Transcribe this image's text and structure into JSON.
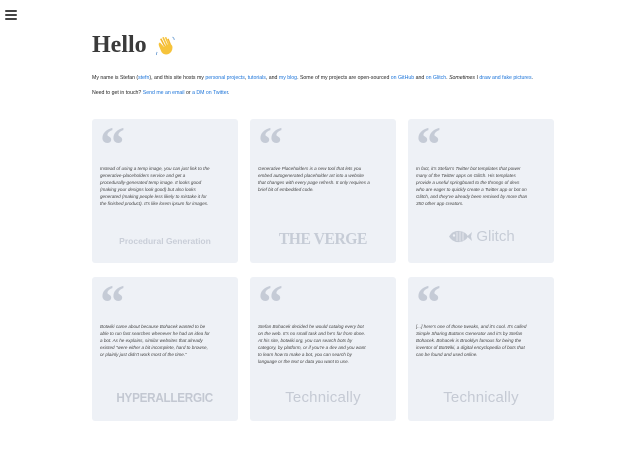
{
  "page": {
    "title": "Hello"
  },
  "intro": {
    "p1_pre": "My name is Stefan (",
    "p1_handle": "stefn",
    "p1_mid1": "), and this site hosts my ",
    "link_projects": "personal projects",
    "sep1": ", ",
    "link_tutorials": "tutorials",
    "sep2": ", and ",
    "link_blog": "my blog",
    "p1_mid2": ". Some of my projects are open-sourced ",
    "link_github": "on GitHub",
    "sep3": " and ",
    "link_glitch": "on Glitch",
    "sep4": ". ",
    "sometimes": "Sometimes",
    "sep5": " I ",
    "link_draw": "draw and fake pictures",
    "end": ".",
    "p2_pre": "Need to get in touch? ",
    "link_email": "Send me an email",
    "p2_or": " or ",
    "link_dm": "a DM on Twitter",
    "p2_end": "."
  },
  "testimonials": [
    {
      "quote": "Instead of using a temp image, you can just link to the generative-placeholders service and get a procedurally-generated temp image. It looks good (making your designs look good) but also looks generated (making people less likely to mistake it for the finished product). It's like lorem ipsum for images.",
      "source": "Procedural Generation"
    },
    {
      "quote": "Generative Placeholders is a new tool that lets you embed autogenerated placeholder art into a website that changes with every page refresh. It only requires a brief bit of embedded code.",
      "source": "THE VERGE"
    },
    {
      "quote": "In fact, it's Stefan's Twitter bot templates that power many of the Twitter apps on Glitch. His templates provide a useful springboard to the throngs of devs who are eager to quickly create a Twitter app or bot on Glitch, and they've already been remixed by more than 350 other app creators.",
      "source": "Glitch"
    },
    {
      "quote": "Botwiki came about because Bohacek wanted to be able to run fast searches whenever he had an idea for a bot. As he explains, similar websites that already existed \"were either a bit incomplete, hard to browse, or plainly just didn't work most of the time.\"",
      "source": "HYPERALLERGIC"
    },
    {
      "quote": "Stefan Bohacek decided he would catalog every bot on the web. It's no small task and he's far from done. At his site, botwiki.org, you can search bots by category, by platform, or if you're a dev and you want to learn how to make a bot, you can search by language or the text or data you want to use.",
      "source": "Technically"
    },
    {
      "quote": "[...] here's one of those tweaks, and it's cool. It's called Simple Sharing Buttons Generator and it's by Stefan Bohacek. Bohacek is Brooklyn famous for being the inventor of BotWiki, a digital encyclopedia of bots that can be found and used online.",
      "source": "Technically"
    }
  ],
  "icons": {
    "menu": "hamburger-menu-icon",
    "wave": "waving-hand-icon",
    "quote": "quotation-mark-icon"
  },
  "colors": {
    "link": "#1a73d9",
    "card_bg": "#eef1f6",
    "logo_gray": "#c5cad4",
    "wave": "#f6c33b"
  }
}
